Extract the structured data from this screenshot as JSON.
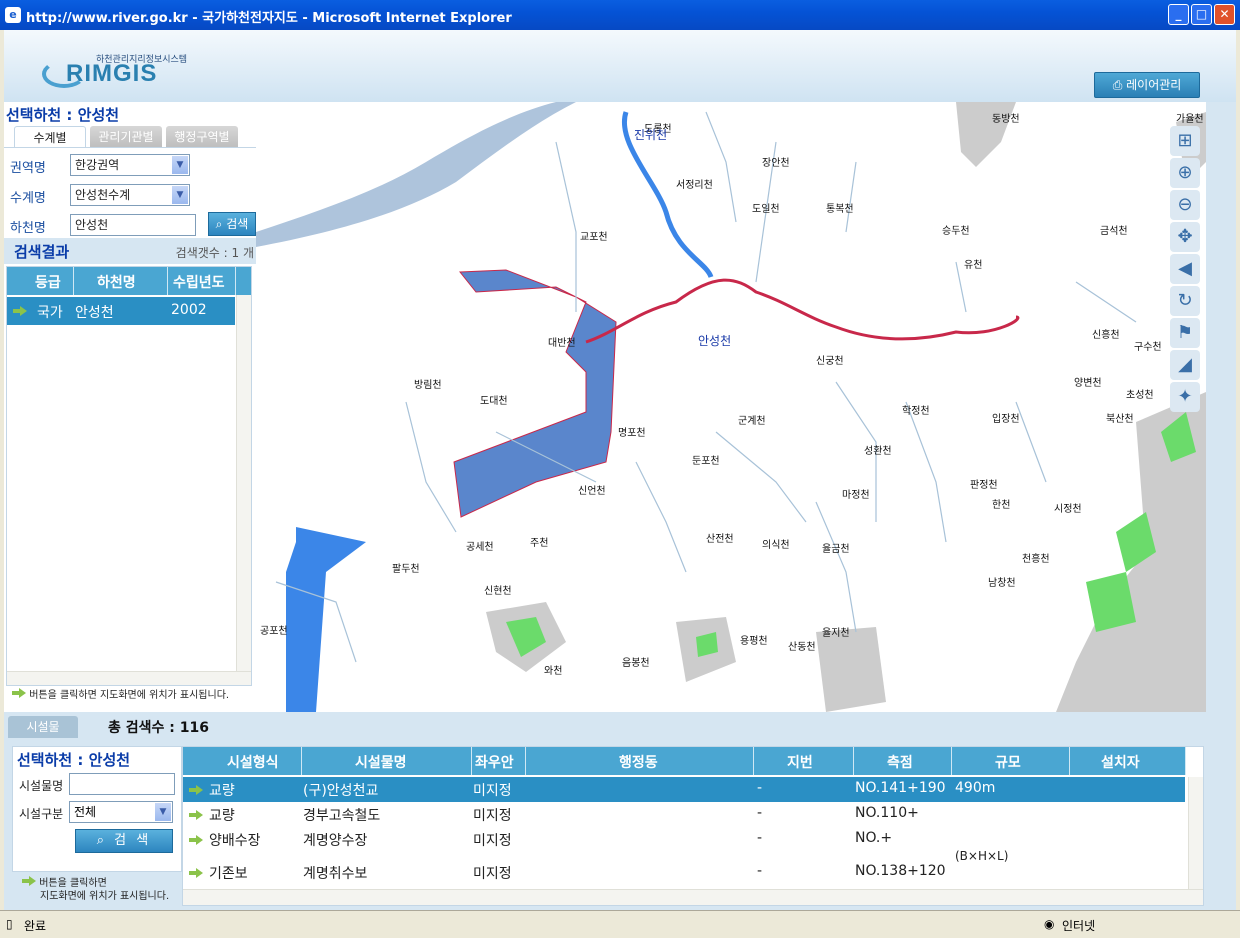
{
  "window": {
    "title": "http://www.river.go.kr - 국가하천전자지도 - Microsoft Internet Explorer"
  },
  "header": {
    "logo_sub": "하천관리지리정보시스템",
    "logo": "RIMGIS",
    "layer_btn": "레이어관리"
  },
  "left": {
    "selected_title": "선택하천 : 안성천",
    "tabs": [
      "수계별",
      "관리기관별",
      "행정구역별"
    ],
    "fields": {
      "region_label": "권역명",
      "region_value": "한강권역",
      "basin_label": "수계명",
      "basin_value": "안성천수계",
      "river_label": "하천명",
      "river_value": "안성천",
      "search_btn": "검색"
    },
    "results_title": "검색결과",
    "results_count": "검색갯수 : 1 개",
    "columns": [
      "등급",
      "하천명",
      "수립년도"
    ],
    "row": {
      "grade": "국가",
      "name": "안성천",
      "year": "2002"
    },
    "hint": "버튼을 클릭하면 지도화면에 위치가 표시됩니다."
  },
  "map": {
    "labels": [
      "진위천",
      "도롱천",
      "장안천",
      "서정리천",
      "도일천",
      "통복천",
      "교포천",
      "승두천",
      "유천",
      "금석천",
      "동방천",
      "가율천",
      "안성천",
      "대반천",
      "방림천",
      "도대천",
      "명포천",
      "군계천",
      "신궁천",
      "학정천",
      "입장천",
      "신흥천",
      "구수천",
      "양변천",
      "초성천",
      "북산천",
      "둔포천",
      "성환천",
      "신언천",
      "마정천",
      "판정천",
      "한천",
      "시정천",
      "공세천",
      "주천",
      "산전천",
      "의식천",
      "율금천",
      "천흥천",
      "남창천",
      "팔두천",
      "신현천",
      "공포천",
      "율지천",
      "용평천",
      "산동천",
      "와천",
      "음봉천"
    ],
    "tools": [
      "zoom-extent-icon",
      "zoom-in-icon",
      "zoom-out-icon",
      "pan-icon",
      "back-icon",
      "refresh-icon",
      "korea-map-icon",
      "measure-icon",
      "move-icon"
    ]
  },
  "bottom": {
    "tab": "시설물",
    "total": "총 검색수 : 116",
    "selected_title": "선택하천 : 안성천",
    "facility_name_label": "시설물명",
    "facility_type_label": "시설구분",
    "facility_type_value": "전체",
    "search_btn": "검 색",
    "hint_1": "버튼을 클릭하면",
    "hint_2": "지도화면에 위치가 표시됩니다.",
    "columns": [
      "시설형식",
      "시설물명",
      "좌우안",
      "행정동",
      "지번",
      "측점",
      "규모",
      "설치자"
    ],
    "rows": [
      {
        "type": "교량",
        "name": "(구)안성천교",
        "side": "미지정",
        "dong": "",
        "jibun": "-",
        "station": "NO.141+190",
        "scale": "490m",
        "installer": ""
      },
      {
        "type": "교량",
        "name": "경부고속철도",
        "side": "미지정",
        "dong": "",
        "jibun": "-",
        "station": "NO.110+",
        "scale": "",
        "installer": ""
      },
      {
        "type": "양배수장",
        "name": "계명양수장",
        "side": "미지정",
        "dong": "",
        "jibun": "-",
        "station": "NO.+",
        "scale": "",
        "installer": ""
      },
      {
        "type": "기존보",
        "name": "계명취수보",
        "side": "미지정",
        "dong": "",
        "jibun": "-",
        "station": "NO.138+120",
        "scale": "(B×H×L)",
        "installer": ""
      }
    ]
  },
  "status": {
    "left": "완료",
    "right": "인터넷"
  }
}
